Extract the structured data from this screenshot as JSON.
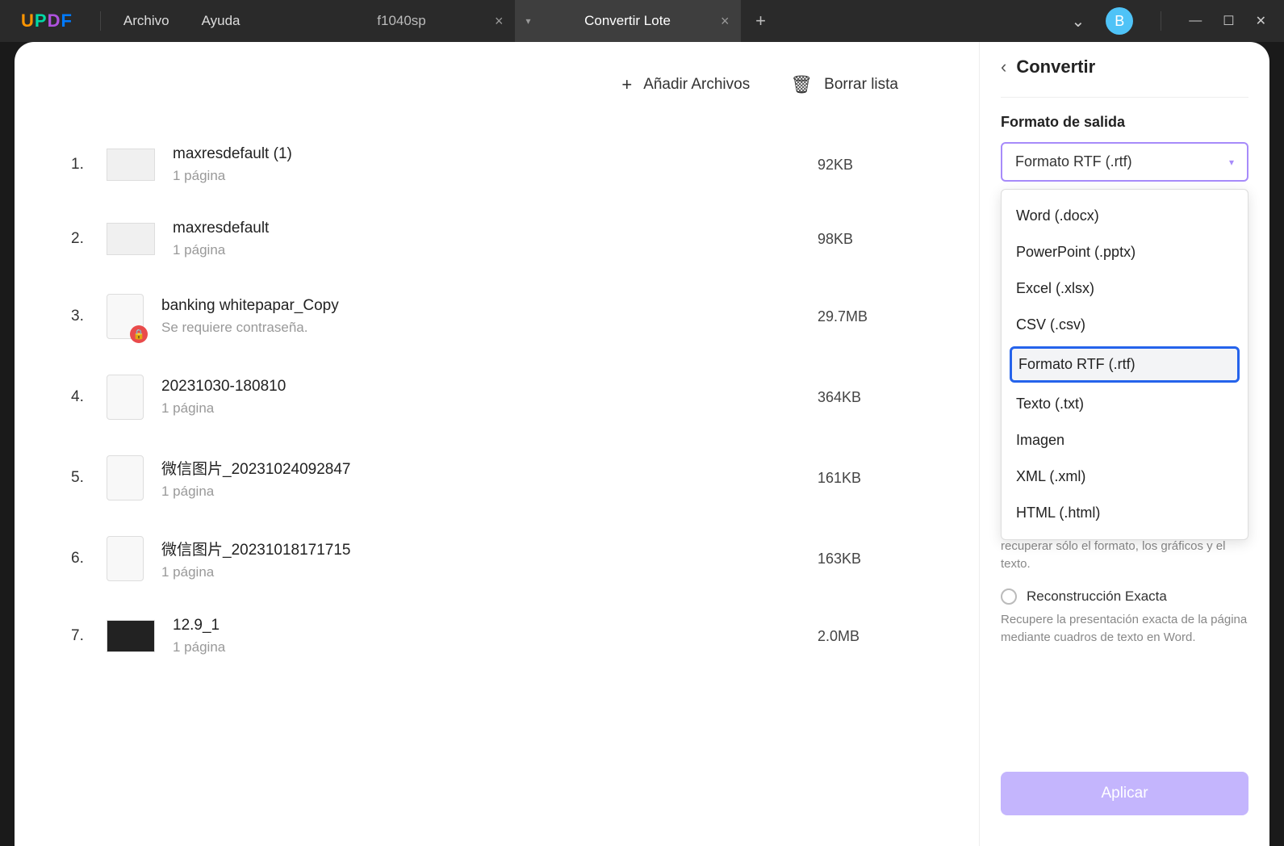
{
  "titlebar": {
    "logo_letters": {
      "u": "U",
      "p": "P",
      "d": "D",
      "f": "F"
    },
    "menu": {
      "archivo": "Archivo",
      "ayuda": "Ayuda"
    },
    "tabs": [
      {
        "label": "f1040sp",
        "active": false
      },
      {
        "label": "Convertir Lote",
        "active": true
      }
    ],
    "avatar_letter": "B"
  },
  "toolbar": {
    "add_files": "Añadir Archivos",
    "clear_list": "Borrar lista"
  },
  "files": [
    {
      "num": "1.",
      "name": "maxresdefault (1)",
      "sub": "1 página",
      "size": "92KB",
      "thumb": "img"
    },
    {
      "num": "2.",
      "name": "maxresdefault",
      "sub": "1 página",
      "size": "98KB",
      "thumb": "img"
    },
    {
      "num": "3.",
      "name": "banking whitepapar_Copy",
      "sub": "Se requiere contraseña.",
      "size": "29.7MB",
      "thumb": "locked"
    },
    {
      "num": "4.",
      "name": "20231030-180810",
      "sub": "1 página",
      "size": "364KB",
      "thumb": "doc"
    },
    {
      "num": "5.",
      "name": "微信图片_20231024092847",
      "sub": "1 página",
      "size": "161KB",
      "thumb": "doc"
    },
    {
      "num": "6.",
      "name": "微信图片_20231018171715",
      "sub": "1 página",
      "size": "163KB",
      "thumb": "doc"
    },
    {
      "num": "7.",
      "name": "12.9_1",
      "sub": "1 página",
      "size": "2.0MB",
      "thumb": "dark"
    }
  ],
  "side": {
    "title": "Convertir",
    "format_label": "Formato de salida",
    "selected_format": "Formato RTF (.rtf)",
    "options": [
      "Word (.docx)",
      "PowerPoint (.pptx)",
      "Excel (.xlsx)",
      "CSV (.csv)",
      "Formato RTF (.rtf)",
      "Texto (.txt)",
      "Imagen",
      "XML (.xml)",
      "HTML (.html)"
    ],
    "desc1": "Detectar el diseño y las columnas, pero recuperar sólo el formato, los gráficos y el texto.",
    "radio2_label": "Reconstrucción Exacta",
    "desc2": "Recupere la presentación exacta de la página mediante cuadros de texto en Word.",
    "apply": "Aplicar"
  }
}
